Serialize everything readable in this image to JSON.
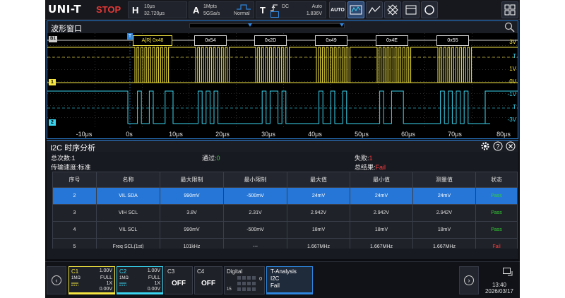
{
  "topbar": {
    "brand": "UNI-T",
    "run_state": "STOP",
    "horizontal": {
      "key": "H",
      "timebase": "10μs",
      "position": "32.720μs"
    },
    "acquire": {
      "key": "A",
      "memory_depth": "1Mpts",
      "sample_rate": "5GSa/s",
      "mode": "Normal"
    },
    "trigger": {
      "key": "T",
      "coupling": "DC",
      "sweep": "Auto",
      "level": "1.836V"
    },
    "buttons": {
      "auto": "AUTO"
    }
  },
  "wave_window": {
    "title": "波形窗口",
    "bus_marker": "B1",
    "bus_frames": [
      "A[R] 0x48",
      "0x54",
      "0x2D",
      "0x49",
      "0x4E",
      "0x55"
    ],
    "ch1_marker": "1",
    "ch2_marker": "2",
    "trigger_marker": "T",
    "right_labels": [
      "3V",
      "T",
      "1V",
      "0V",
      "-1V",
      "T",
      "-3V"
    ],
    "x_ticks": [
      "-10μs",
      "0s",
      "10μs",
      "20μs",
      "30μs",
      "40μs",
      "50μs",
      "60μs",
      "70μs",
      "80μs"
    ]
  },
  "analysis": {
    "title": "I2C 时序分析",
    "total_label": "总次数:",
    "total_value": "1",
    "pass_label": "通过:",
    "pass_value": "0",
    "fail_label": "失败:",
    "fail_value": "1",
    "speed_label": "传输速度:",
    "speed_value": "标准",
    "result_label": "总结果:",
    "result_value": "Fail",
    "columns": [
      "序号",
      "名称",
      "最大限制",
      "最小限制",
      "最大值",
      "最小值",
      "测量值",
      "状态"
    ],
    "rows": [
      {
        "no": "2",
        "name": "VIL SDA",
        "max_limit": "990mV",
        "min_limit": "-500mV",
        "max": "24mV",
        "min": "24mV",
        "measured": "24mV",
        "status": "Pass",
        "selected": true
      },
      {
        "no": "3",
        "name": "VIH SCL",
        "max_limit": "3.8V",
        "min_limit": "2.31V",
        "max": "2.942V",
        "min": "2.942V",
        "measured": "2.942V",
        "status": "Pass",
        "selected": false
      },
      {
        "no": "4",
        "name": "VIL SCL",
        "max_limit": "990mV",
        "min_limit": "-500mV",
        "max": "18mV",
        "min": "18mV",
        "measured": "18mV",
        "status": "Pass",
        "selected": false
      },
      {
        "no": "5",
        "name": "Freq SCL(1st)",
        "max_limit": "101kHz",
        "min_limit": "---",
        "max": "1.667MHz",
        "min": "1.667MHz",
        "measured": "1.667MHz",
        "status": "Fail",
        "selected": false
      }
    ]
  },
  "bottombar": {
    "c1": {
      "name": "C1",
      "scale": "1.00V",
      "impedance": "1MΩ",
      "bandwidth": "FULL",
      "probe": "1X",
      "offset": "0.00V"
    },
    "c2": {
      "name": "C2",
      "scale": "1.00V",
      "impedance": "1MΩ",
      "bandwidth": "FULL",
      "probe": "1X",
      "offset": "0.00V"
    },
    "c3": {
      "name": "C3",
      "state": "OFF"
    },
    "c4": {
      "name": "C4",
      "state": "OFF"
    },
    "digital": {
      "name": "Digital",
      "low": "0",
      "high": "15"
    },
    "t_analysis": {
      "name": "T-Analysis",
      "protocol": "I2C",
      "result": "Fail"
    },
    "time": "13:40",
    "date": "2026/03/17"
  },
  "colors": {
    "ch1": "#f5e642",
    "ch2": "#3ad5f0",
    "accent": "#2e86de",
    "pass": "#33d433",
    "fail": "#ff3b3b",
    "stop": "#e53935"
  }
}
